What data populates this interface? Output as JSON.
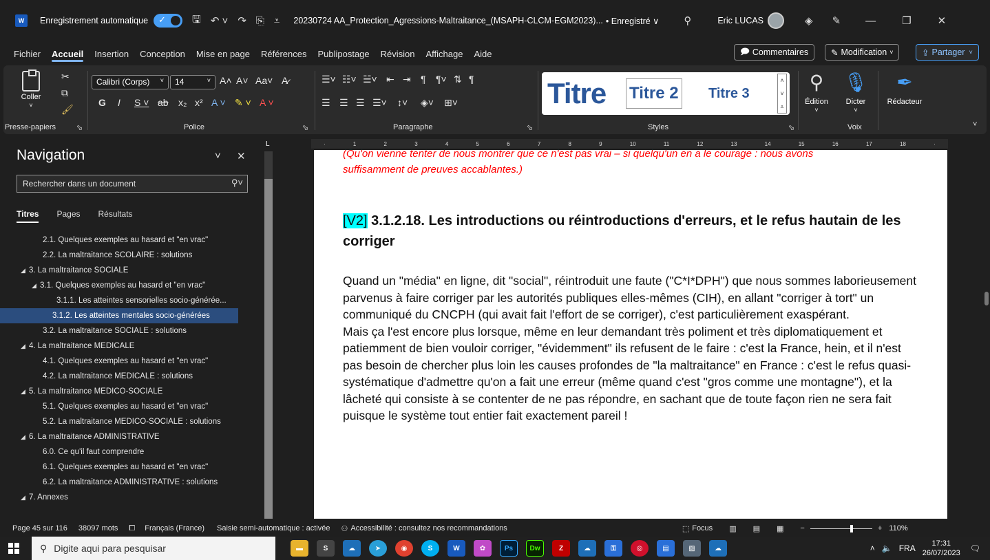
{
  "titlebar": {
    "autosave_label": "Enregistrement automatique",
    "doc_title": "20230724 AA_Protection_Agressions-Maltraitance_(MSAPH-CLCM-EGM2023)...",
    "saved": "• Enregistré ∨",
    "user": "Eric LUCAS"
  },
  "menu": {
    "tabs": [
      "Fichier",
      "Accueil",
      "Insertion",
      "Conception",
      "Mise en page",
      "Références",
      "Publipostage",
      "Révision",
      "Affichage",
      "Aide"
    ],
    "comments": "Commentaires",
    "modification": "Modification",
    "share": "Partager"
  },
  "ribbon": {
    "paste": "Coller",
    "font_name": "Calibri (Corps)",
    "font_size": "14",
    "styles": {
      "t1": "Titre",
      "t2": "Titre 2",
      "t3": "Titre 3"
    },
    "edition": "Édition",
    "dicter": "Dicter",
    "redacteur": "Rédacteur",
    "group_labels": {
      "clipboard": "Presse-papiers",
      "font": "Police",
      "paragraph": "Paragraphe",
      "styles": "Styles",
      "voice": "Voix"
    }
  },
  "nav": {
    "title": "Navigation",
    "search_placeholder": "Rechercher dans un document",
    "tabs": {
      "titres": "Titres",
      "pages": "Pages",
      "resultats": "Résultats"
    },
    "items": [
      "2.1. Quelques exemples au hasard et \"en vrac\"",
      "2.2. La maltraitance SCOLAIRE : solutions",
      "3. La maltraitance SOCIALE",
      "3.1. Quelques exemples au hasard et \"en vrac\"",
      "3.1.1. Les atteintes sensorielles socio-générée...",
      "3.1.2. Les atteintes mentales socio-générées",
      "3.2. La maltraitance SOCIALE : solutions",
      "4. La maltraitance MEDICALE",
      "4.1. Quelques exemples au hasard et \"en vrac\"",
      "4.2. La maltraitance MEDICALE : solutions",
      "5. La maltraitance MEDICO-SOCIALE",
      "5.1. Quelques exemples au hasard et \"en vrac\"",
      "5.2. La maltraitance MEDICO-SOCIALE : solutions",
      "6. La maltraitance ADMINISTRATIVE",
      "6.0. Ce qu'il faut comprendre",
      "6.1. Quelques exemples au hasard et \"en vrac\"",
      "6.2. La maltraitance ADMINISTRATIVE : solutions",
      "7. Annexes"
    ]
  },
  "doc": {
    "red_line1": "(Qu'on vienne tenter de nous montrer que ce n'est pas vrai – si quelqu'un en a le courage : nous avons",
    "red_line2": "suffisamment de preuves accablantes.)",
    "heading_tag": "[V2]",
    "heading": " 3.1.2.18. Les introductions ou réintroductions d'erreurs, et le refus hautain de les corriger",
    "para1": "Quand un \"média\" en ligne, dit \"social\", réintroduit une faute (\"C*I*DPH\") que nous sommes laborieusement parvenus à faire corriger par les autorités publiques elles-mêmes (CIH), en allant \"corriger à tort\" un communiqué du CNCPH (qui avait fait l'effort de se corriger), c'est particulièrement exaspérant.",
    "para2": "Mais ça l'est encore plus lorsque, même en leur demandant très poliment et très diplomatiquement et patiemment de bien vouloir corriger, \"évidemment\" ils refusent de le faire : c'est la France, hein, et il n'est pas besoin de chercher plus loin les causes profondes de \"la maltraitance\" en France : c'est le refus quasi-systématique d'admettre qu'on a fait une erreur (même quand c'est \"gros comme une montagne\"), et la lâcheté qui consiste à se contenter de ne pas répondre, en sachant que de toute façon rien ne sera fait puisque le système tout entier fait exactement pareil !"
  },
  "status": {
    "page": "Page 45 sur 116",
    "words": "38097 mots",
    "lang": "Français (France)",
    "autocomplete": "Saisie semi-automatique : activée",
    "accessibility": "Accessibilité : consultez nos recommandations",
    "focus": "Focus",
    "zoom": "110%"
  },
  "taskbar": {
    "search_placeholder": "Digite aqui para pesquisar",
    "lang": "FRA",
    "time": "17:31",
    "date": "26/07/2023"
  }
}
